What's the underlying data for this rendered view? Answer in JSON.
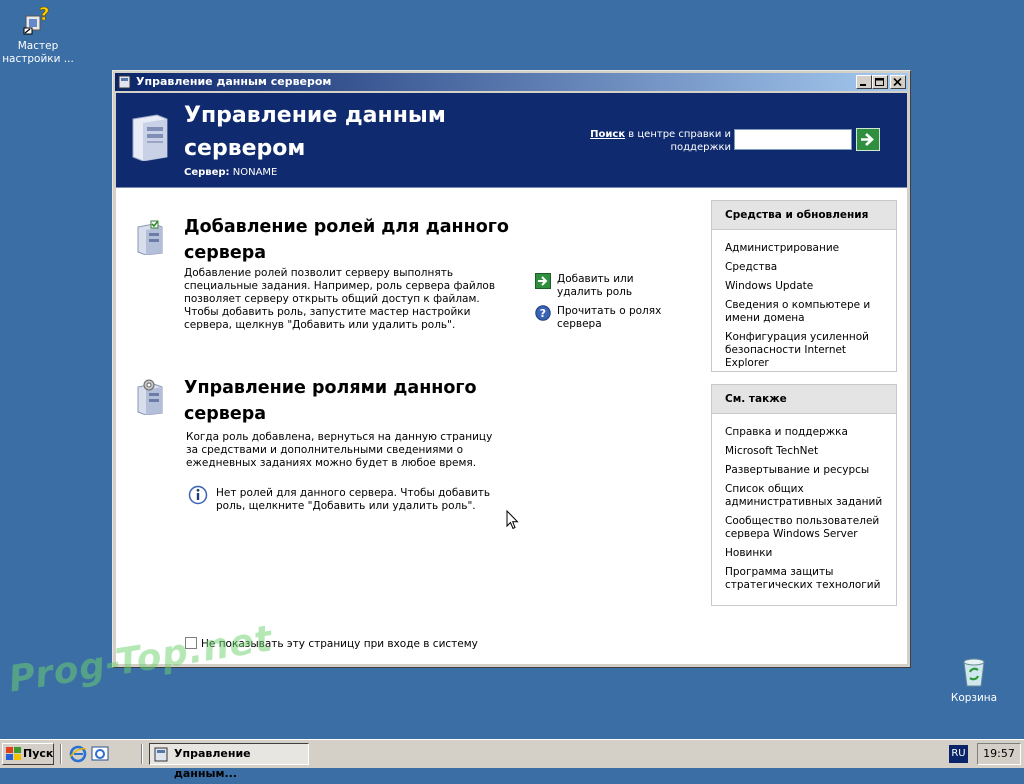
{
  "desktop": {
    "wizard_label": "Мастер настройки ...",
    "recycle_label": "Корзина"
  },
  "window": {
    "title": "Управление данным сервером"
  },
  "header": {
    "title": "Управление данным сервером",
    "server_label": "Сервер:",
    "server_name": "NONAME",
    "search_label_bold": "Поиск",
    "search_label_rest": "в центре справки и поддержки",
    "search_value": ""
  },
  "sections": {
    "add_roles": {
      "title": "Добавление ролей для данного сервера",
      "description": "Добавление ролей позволит серверу выполнять специальные задания. Например, роль сервера файлов позволяет серверу открыть общий доступ к файлам. Чтобы добавить роль, запустите мастер настройки сервера, щелкнув \"Добавить или удалить роль\"."
    },
    "manage_roles": {
      "title": "Управление ролями данного сервера",
      "description": "Когда роль добавлена, вернуться на данную страницу за средствами и дополнительными сведениями о ежедневных заданиях можно будет в любое время.",
      "info": "Нет ролей для данного сервера. Чтобы добавить роль, щелкните \"Добавить или удалить роль\"."
    }
  },
  "actions": {
    "add_remove_role": "Добавить или удалить роль",
    "read_about_roles": "Прочитать о ролях сервера"
  },
  "panels": {
    "tools": {
      "title": "Средства и обновления",
      "items": [
        "Администрирование",
        "Средства",
        "Windows Update",
        "Сведения о компьютере и имени домена",
        "Конфигурация усиленной безопасности Internet Explorer"
      ]
    },
    "see_also": {
      "title": "См. также",
      "items": [
        "Справка и поддержка",
        "Microsoft TechNet",
        "Развертывание и ресурсы",
        "Список общих административных заданий",
        "Сообщество пользователей сервера Windows Server",
        "Новинки",
        "Программа защиты стратегических технологий"
      ]
    }
  },
  "footer": {
    "dont_show": "Не показывать эту страницу при входе в систему"
  },
  "watermark": "Prog-Top.net",
  "taskbar": {
    "start_label": "Пуск",
    "task_label": "Управление данным...",
    "lang": "RU",
    "clock": "19:57"
  },
  "colors": {
    "desktop": "#3a6ea5",
    "header_band": "#0f2a6e",
    "title_bar_start": "#0a246a",
    "title_bar_end": "#a6caf0"
  }
}
